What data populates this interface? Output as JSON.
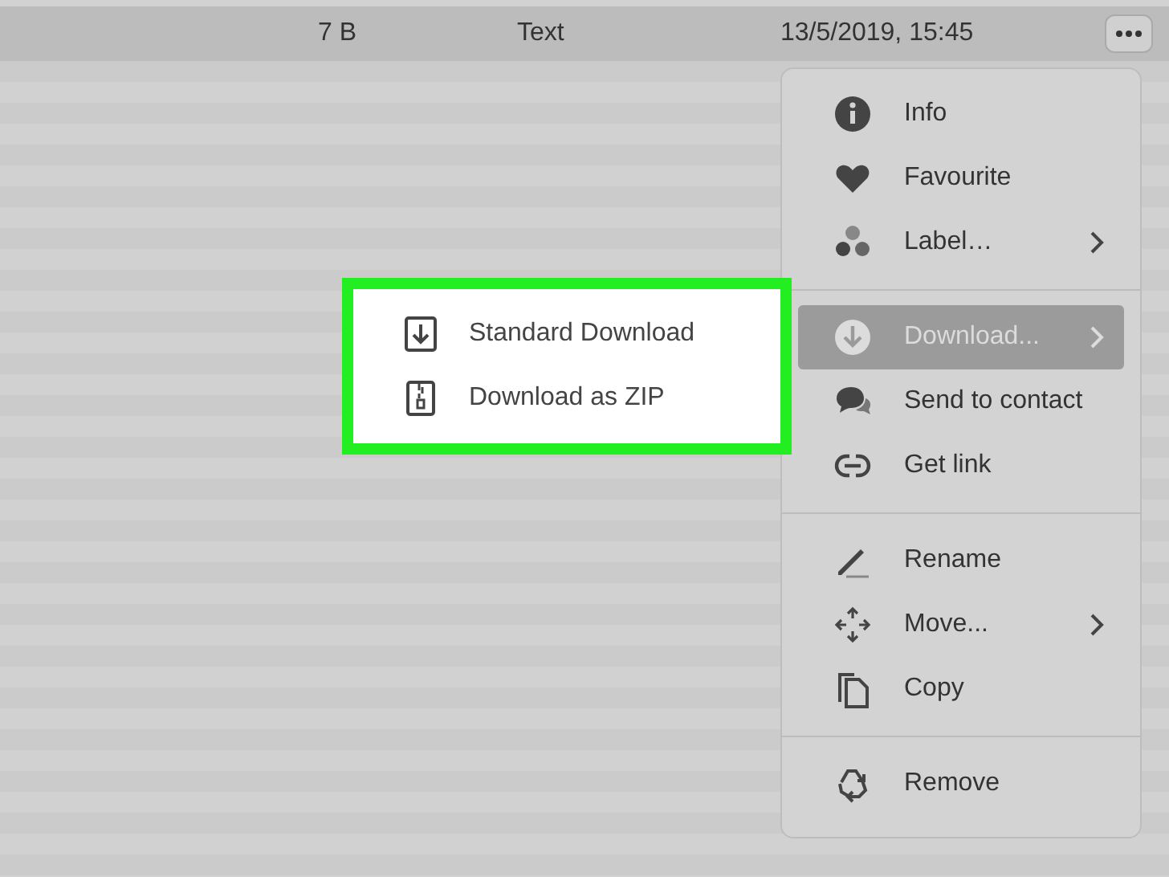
{
  "file_row": {
    "size": "7 B",
    "type": "Text",
    "modified": "13/5/2019, 15:45",
    "selected": true
  },
  "context_menu": {
    "items": [
      {
        "kind": "item",
        "label": "Info",
        "submenu": false,
        "selected": false
      },
      {
        "kind": "item",
        "label": "Favourite",
        "submenu": false,
        "selected": false
      },
      {
        "kind": "item",
        "label": "Label…",
        "submenu": true,
        "selected": false
      },
      {
        "kind": "divider"
      },
      {
        "kind": "item",
        "label": "Download...",
        "submenu": true,
        "selected": true
      },
      {
        "kind": "item",
        "label": "Send to contact",
        "submenu": false,
        "selected": false
      },
      {
        "kind": "item",
        "label": "Get link",
        "submenu": false,
        "selected": false
      },
      {
        "kind": "divider"
      },
      {
        "kind": "item",
        "label": "Rename",
        "submenu": false,
        "selected": false
      },
      {
        "kind": "item",
        "label": "Move...",
        "submenu": true,
        "selected": false
      },
      {
        "kind": "item",
        "label": "Copy",
        "submenu": false,
        "selected": false
      },
      {
        "kind": "divider"
      },
      {
        "kind": "item",
        "label": "Remove",
        "submenu": false,
        "selected": false
      }
    ]
  },
  "download_submenu": {
    "items": [
      {
        "label": "Standard Download"
      },
      {
        "label": "Download as ZIP"
      }
    ]
  }
}
